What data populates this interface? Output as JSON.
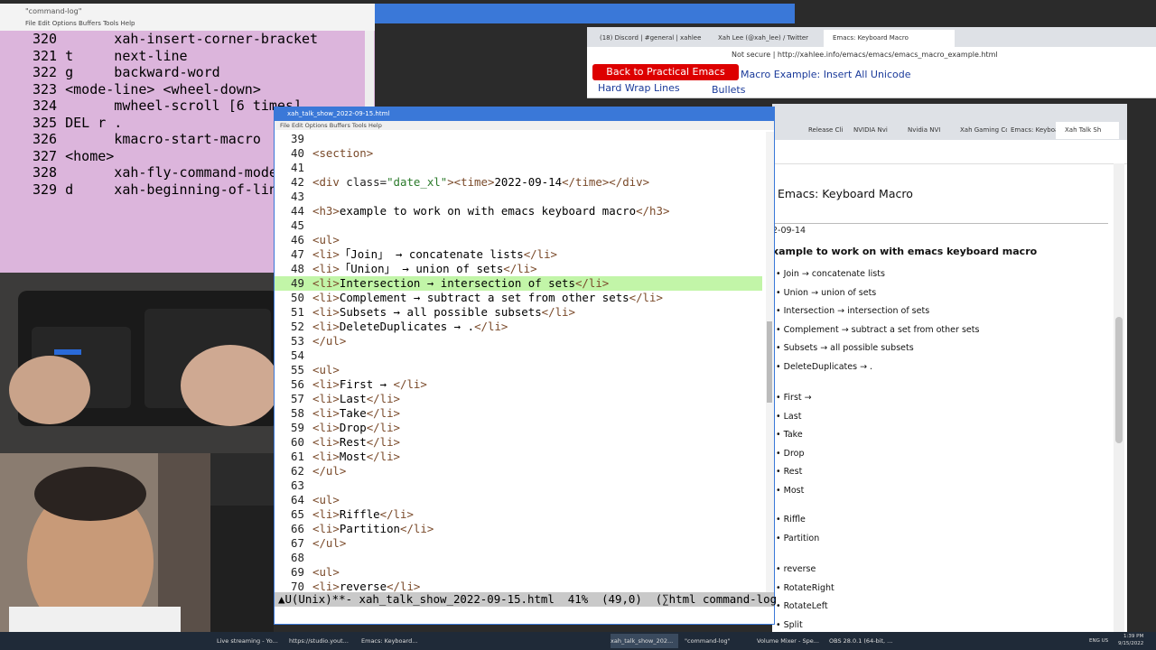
{
  "cmdlog": {
    "title": "\"command-log\"",
    "menu": "File  Edit  Options  Buffers  Tools  Help",
    "lines": [
      "320       xah-insert-corner-bracket",
      "321 t     next-line",
      "322 g     backward-word",
      "323 <mode-line> <wheel-down>",
      "324       mwheel-scroll [6 times]",
      "325 DEL r .",
      "326       kmacro-start-macro",
      "327 <home>",
      "328       xah-fly-command-mode",
      "329 d     xah-beginning-of-line"
    ]
  },
  "browser": {
    "tabs": [
      "(18) Discord | #general | xahlee",
      "Xah Lee (@xah_lee) / Twitter",
      "Emacs: Keyboard Macro"
    ],
    "url": "Not secure | http://xahlee.info/emacs/emacs/emacs_macro_example.html",
    "tutorial_button": "Back to Practical Emacs Tutorial",
    "hard_wrap": "Hard Wrap Lines",
    "macro_link": "Macro Example: Insert All Unicode",
    "bullets": "Bullets"
  },
  "rbrowser": {
    "tabs": [
      "Release Cli",
      "NVIDIA Nvi",
      "Nvidia NVI",
      "Xah Gaming Co",
      "Emacs: Keyboa",
      "Xah Talk Sh"
    ],
    "page_title": "Emacs: Keyboard Macro",
    "date": "2-09-14",
    "h3": "xample to work on with emacs keyboard macro",
    "list1": [
      "Join → concatenate lists",
      "Union → union of sets",
      "Intersection → intersection of sets",
      "Complement → subtract a set from other sets",
      "Subsets → all possible subsets",
      "DeleteDuplicates → ."
    ],
    "list2": [
      "First →",
      "Last",
      "Take",
      "Drop",
      "Rest",
      "Most"
    ],
    "list3": [
      "Riffle",
      "Partition"
    ],
    "list4": [
      "reverse",
      "RotateRight",
      "RotateLeft",
      "Split"
    ]
  },
  "emacs": {
    "title": "xah_talk_show_2022-09-15.html",
    "menu": "File  Edit  Options  Buffers  Tools  Help",
    "lines": [
      {
        "n": "39",
        "t": ""
      },
      {
        "n": "40",
        "t": "<section>"
      },
      {
        "n": "41",
        "t": ""
      },
      {
        "n": "42",
        "t": "<div class=\"date_xl\"><time>2022-09-14</time></div>"
      },
      {
        "n": "43",
        "t": ""
      },
      {
        "n": "44",
        "t": "<h3>example to work on with emacs keyboard macro</h3>"
      },
      {
        "n": "45",
        "t": ""
      },
      {
        "n": "46",
        "t": "<ul>"
      },
      {
        "n": "47",
        "t": "<li>「Join」 → concatenate lists</li>"
      },
      {
        "n": "48",
        "t": "<li>「Union」 → union of sets</li>"
      },
      {
        "n": "49",
        "t": "<li>Intersection → intersection of sets</li>",
        "hl": true
      },
      {
        "n": "50",
        "t": "<li>Complement → subtract a set from other sets</li>"
      },
      {
        "n": "51",
        "t": "<li>Subsets → all possible subsets</li>"
      },
      {
        "n": "52",
        "t": "<li>DeleteDuplicates → .</li>"
      },
      {
        "n": "53",
        "t": "</ul>"
      },
      {
        "n": "54",
        "t": ""
      },
      {
        "n": "55",
        "t": "<ul>"
      },
      {
        "n": "56",
        "t": "<li>First → </li>"
      },
      {
        "n": "57",
        "t": "<li>Last</li>"
      },
      {
        "n": "58",
        "t": "<li>Take</li>"
      },
      {
        "n": "59",
        "t": "<li>Drop</li>"
      },
      {
        "n": "60",
        "t": "<li>Rest</li>"
      },
      {
        "n": "61",
        "t": "<li>Most</li>"
      },
      {
        "n": "62",
        "t": "</ul>"
      },
      {
        "n": "63",
        "t": ""
      },
      {
        "n": "64",
        "t": "<ul>"
      },
      {
        "n": "65",
        "t": "<li>Riffle</li>"
      },
      {
        "n": "66",
        "t": "<li>Partition</li>"
      },
      {
        "n": "67",
        "t": "</ul>"
      },
      {
        "n": "68",
        "t": ""
      },
      {
        "n": "69",
        "t": "<ul>"
      },
      {
        "n": "70",
        "t": "<li>reverse</li>"
      }
    ],
    "modeline": "▲U(Unix)**- xah_talk_show_2022-09-15.html  41%  (49,0)  (∑html command-log"
  },
  "taskbar": {
    "items": [
      "Live streaming - Yo...",
      "https://studio.yout...",
      "Emacs: Keyboard...",
      "xah_talk_show_202...",
      "\"command-log\"",
      "Volume Mixer - Spe...",
      "OBS 28.0.1 (64-bit, ..."
    ],
    "clock_time": "1:39 PM",
    "clock_date": "9/15/2022",
    "lang": "ENG US"
  },
  "colors": {
    "cmdlog_bg": "#dcb5dc",
    "highlight": "#c2f5a8",
    "accent": "#3a78d8",
    "tutorial_btn": "#dd0000"
  }
}
